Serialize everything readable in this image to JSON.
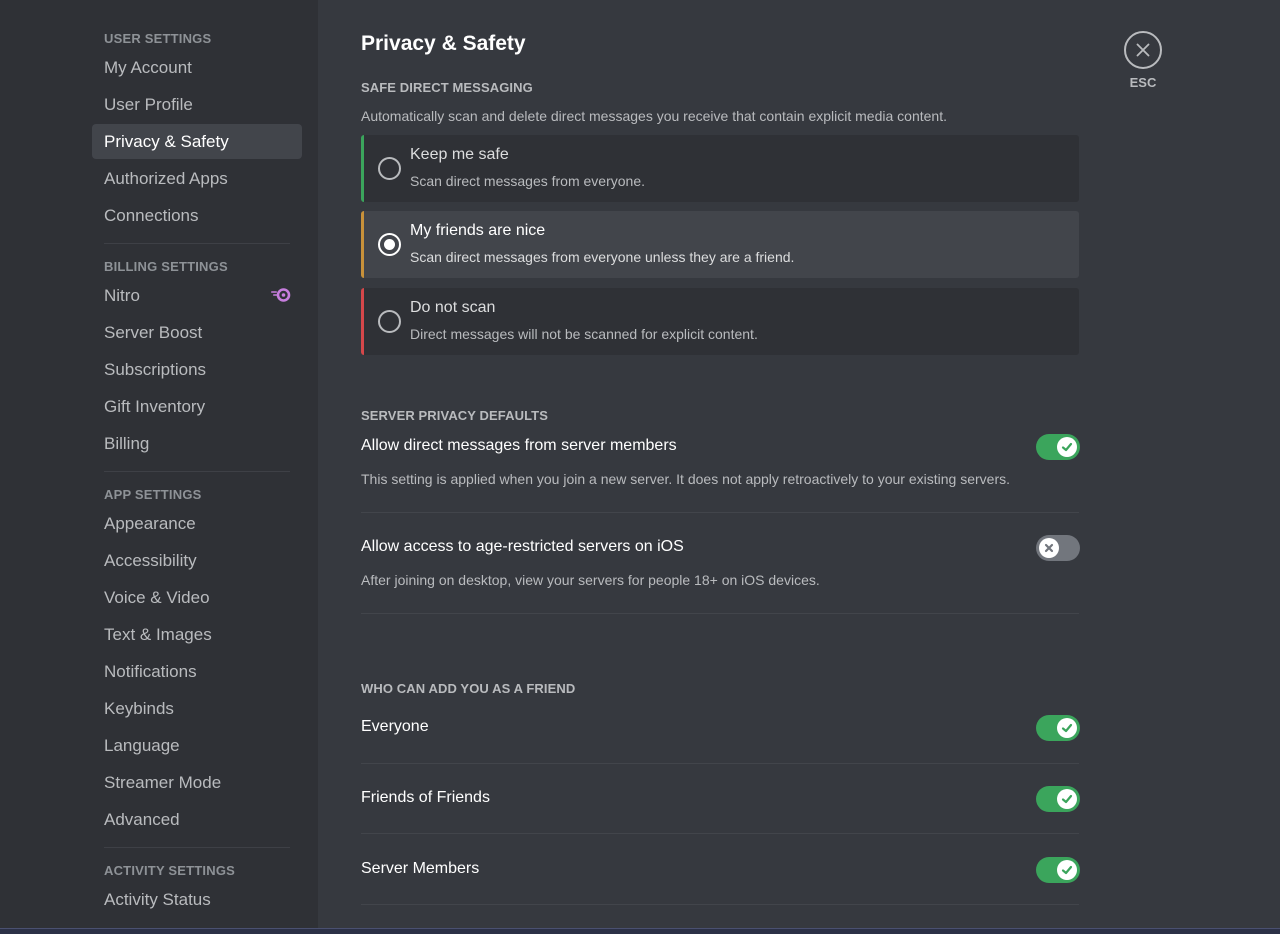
{
  "sidebar": {
    "sections": [
      {
        "header": "USER SETTINGS",
        "items": [
          {
            "label": "My Account"
          },
          {
            "label": "User Profile"
          },
          {
            "label": "Privacy & Safety",
            "active": true
          },
          {
            "label": "Authorized Apps"
          },
          {
            "label": "Connections"
          }
        ]
      },
      {
        "header": "BILLING SETTINGS",
        "items": [
          {
            "label": "Nitro",
            "icon": "nitro-icon"
          },
          {
            "label": "Server Boost"
          },
          {
            "label": "Subscriptions"
          },
          {
            "label": "Gift Inventory"
          },
          {
            "label": "Billing"
          }
        ]
      },
      {
        "header": "APP SETTINGS",
        "items": [
          {
            "label": "Appearance"
          },
          {
            "label": "Accessibility"
          },
          {
            "label": "Voice & Video"
          },
          {
            "label": "Text & Images"
          },
          {
            "label": "Notifications"
          },
          {
            "label": "Keybinds"
          },
          {
            "label": "Language"
          },
          {
            "label": "Streamer Mode"
          },
          {
            "label": "Advanced"
          }
        ]
      },
      {
        "header": "ACTIVITY SETTINGS",
        "items": [
          {
            "label": "Activity Status"
          }
        ]
      }
    ]
  },
  "main": {
    "title": "Privacy & Safety",
    "safe_dm": {
      "header": "SAFE DIRECT MESSAGING",
      "description": "Automatically scan and delete direct messages you receive that contain explicit media content.",
      "options": [
        {
          "title": "Keep me safe",
          "subtitle": "Scan direct messages from everyone.",
          "color": "#3ba55c",
          "selected": false
        },
        {
          "title": "My friends are nice",
          "subtitle": "Scan direct messages from everyone unless they are a friend.",
          "color": "#c8913a",
          "selected": true
        },
        {
          "title": "Do not scan",
          "subtitle": "Direct messages will not be scanned for explicit content.",
          "color": "#d5474a",
          "selected": false
        }
      ]
    },
    "server_privacy": {
      "header": "SERVER PRIVACY DEFAULTS",
      "settings": [
        {
          "title": "Allow direct messages from server members",
          "description": "This setting is applied when you join a new server. It does not apply retroactively to your existing servers.",
          "enabled": true
        },
        {
          "title": "Allow access to age-restricted servers on iOS",
          "description": "After joining on desktop, view your servers for people 18+ on iOS devices.",
          "enabled": false
        }
      ]
    },
    "friend_requests": {
      "header": "WHO CAN ADD YOU AS A FRIEND",
      "settings": [
        {
          "title": "Everyone",
          "enabled": true
        },
        {
          "title": "Friends of Friends",
          "enabled": true
        },
        {
          "title": "Server Members",
          "enabled": true
        }
      ]
    }
  },
  "close": {
    "label": "ESC",
    "icon": "close-icon"
  },
  "colors": {
    "toggle_on": "#3ba55c",
    "toggle_off": "#72767d",
    "nitro": "#c77ede"
  }
}
